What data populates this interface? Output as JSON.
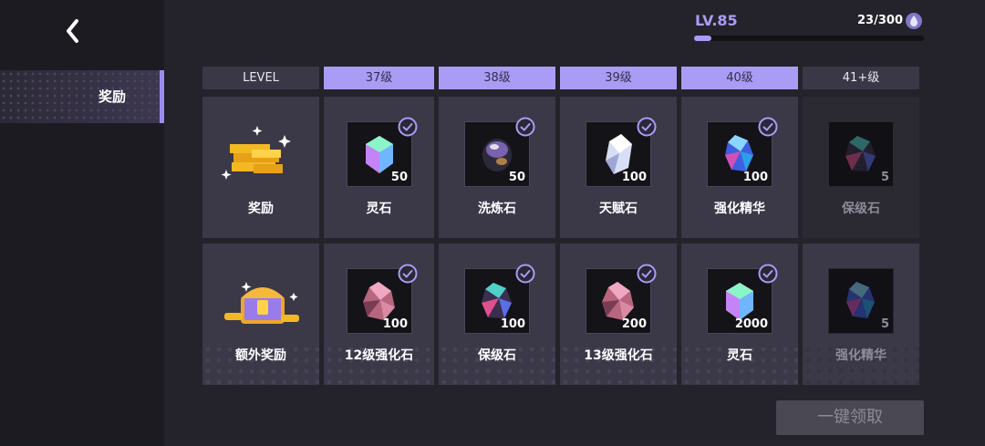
{
  "nav": {
    "back_icon": "chevron-left-icon",
    "item_label": "奖励"
  },
  "progress": {
    "level": "LV.85",
    "count": "23/300",
    "fraction": 0.077,
    "icon": "water-drop-icon"
  },
  "headers": [
    "LEVEL",
    "37级",
    "38级",
    "39级",
    "40级",
    "41+级"
  ],
  "active_headers": [
    false,
    true,
    true,
    true,
    true,
    false
  ],
  "row_labels": [
    "奖励",
    "额外奖励"
  ],
  "row1": [
    {
      "name": "灵石",
      "qty": "50",
      "claimed": true,
      "gem": "rainbow-crystal",
      "locked": false
    },
    {
      "name": "洗炼石",
      "qty": "50",
      "claimed": true,
      "gem": "dark-orb",
      "locked": false
    },
    {
      "name": "天赋石",
      "qty": "100",
      "claimed": true,
      "gem": "white-crystal",
      "locked": false
    },
    {
      "name": "强化精华",
      "qty": "100",
      "claimed": true,
      "gem": "blue-cluster",
      "locked": false
    },
    {
      "name": "保级石",
      "qty": "5",
      "claimed": false,
      "gem": "dark-cluster",
      "locked": true
    }
  ],
  "row2": [
    {
      "name": "12级强化石",
      "qty": "100",
      "claimed": true,
      "gem": "pink-rock",
      "locked": false
    },
    {
      "name": "保级石",
      "qty": "100",
      "claimed": true,
      "gem": "dark-cluster",
      "locked": false
    },
    {
      "name": "13级强化石",
      "qty": "200",
      "claimed": true,
      "gem": "pink-rock",
      "locked": false
    },
    {
      "name": "灵石",
      "qty": "2000",
      "claimed": true,
      "gem": "rainbow-crystal",
      "locked": false
    },
    {
      "name": "强化精华",
      "qty": "5",
      "claimed": false,
      "gem": "blue-cluster",
      "locked": true
    }
  ],
  "claim_button": "一键领取",
  "colors": {
    "accent": "#a99cf5",
    "panel": "#3b3848",
    "bg": "#24222b"
  }
}
